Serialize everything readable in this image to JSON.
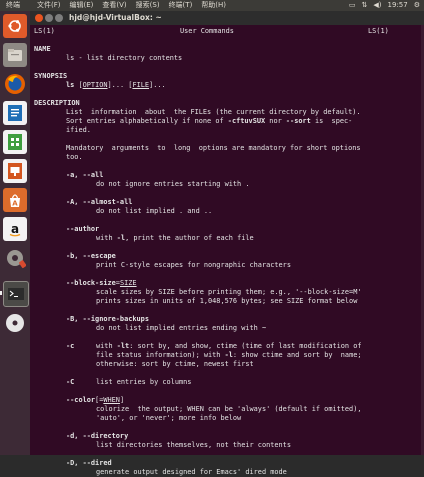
{
  "topbar": {
    "app_name": "终端",
    "menus": [
      "文件(F)",
      "编辑(E)",
      "查看(V)",
      "搜索(S)",
      "终端(T)",
      "帮助(H)"
    ],
    "time": "19:57"
  },
  "launcher": {
    "items": [
      "ubuntu-dash",
      "files",
      "firefox",
      "writer",
      "calc",
      "impress",
      "software-center",
      "amazon",
      "system-settings",
      "terminal",
      "dvd"
    ]
  },
  "window": {
    "title": "hjd@hjd-VirtualBox: ~"
  },
  "man": {
    "header_left": "LS(1)",
    "header_center": "User Commands",
    "header_right": "LS(1)",
    "name_heading": "NAME",
    "name_line": "ls - list directory contents",
    "synopsis_heading": "SYNOPSIS",
    "syn_cmd": "ls",
    "syn_option": "OPTION",
    "syn_file": "FILE",
    "description_heading": "DESCRIPTION",
    "d1": "List  information  about  the FILEs (the current directory by default).",
    "d2a": "Sort entries alphabetically if none of ",
    "d2b": "-cftuvSUX",
    "d2c": " nor ",
    "d2d": "--sort",
    "d2e": " is  spec‐",
    "d3": "ified.",
    "d4": "Mandatory  arguments  to  long  options are mandatory for short options",
    "d5": "too.",
    "o1": "-a, --all",
    "o1d": "do not ignore entries starting with .",
    "o2": "-A, --almost-all",
    "o2d": "do not list implied . and ..",
    "o3": "--author",
    "o3da": "with ",
    "o3db": "-l",
    "o3dc": ", print the author of each file",
    "o4": "-b, --escape",
    "o4d": "print C-style escapes for nongraphic characters",
    "o5": "--block-size",
    "o5arg": "SIZE",
    "o5d1": "scale sizes by SIZE before printing them; e.g., '--block-size=M'",
    "o5d2": "prints sizes in units of 1,048,576 bytes; see SIZE format below",
    "o6": "-B, --ignore-backups",
    "o6d": "do not list implied entries ending with ~",
    "o7": "-c",
    "o7a": "with ",
    "o7b": "-lt",
    "o7c": ": sort by, and show, ctime (time of last modification of",
    "o7d1a": "file status information); with ",
    "o7d1b": "-l",
    "o7d1c": ": show ctime and sort by  name;",
    "o7d2": "otherwise: sort by ctime, newest first",
    "o8": "-C",
    "o8d": "list entries by columns",
    "o9": "--color",
    "o9arg": "WHEN",
    "o9d1": "colorize  the output; WHEN can be 'always' (default if omitted),",
    "o9d2": "'auto', or 'never'; more info below",
    "o10": "-d, --directory",
    "o10d": "list directories themselves, not their contents",
    "o11": "-D, --dired",
    "o11d": "generate output designed for Emacs' dired mode"
  }
}
